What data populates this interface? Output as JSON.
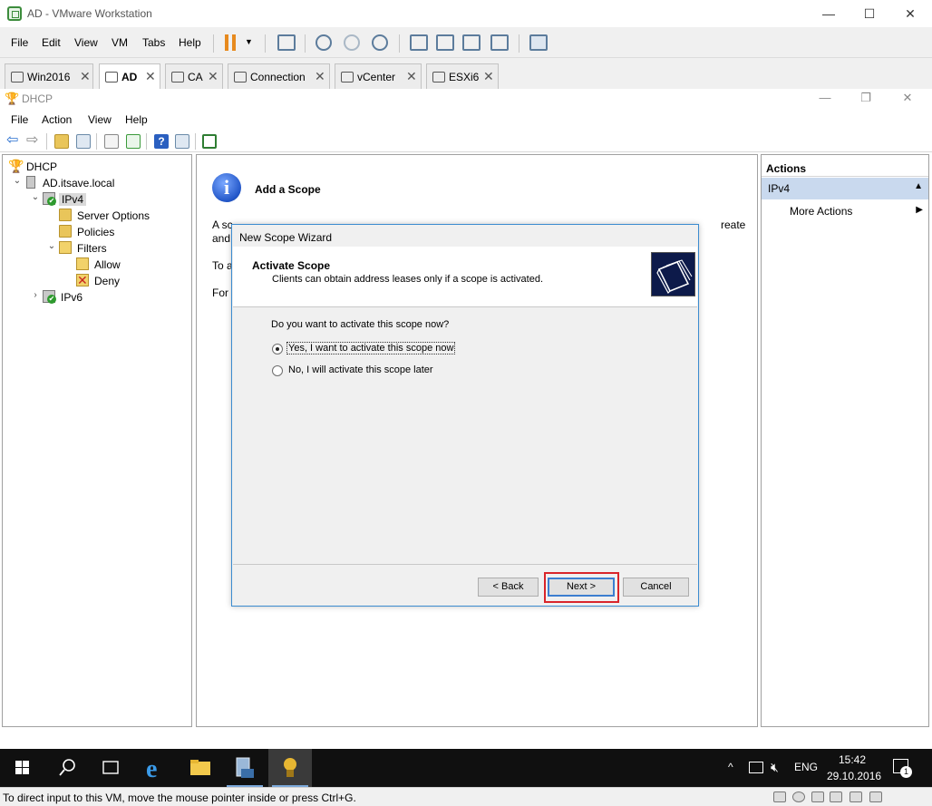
{
  "vmware": {
    "title": "AD - VMware Workstation",
    "window_controls": {
      "minimize": "—",
      "maximize": "☐",
      "close": "✕"
    },
    "menu": [
      "File",
      "Edit",
      "View",
      "VM",
      "Tabs",
      "Help"
    ],
    "tabs": [
      {
        "label": "Win2016",
        "active": false
      },
      {
        "label": "AD",
        "active": true
      },
      {
        "label": "CA",
        "active": false
      },
      {
        "label": "Connection",
        "active": false
      },
      {
        "label": "vCenter",
        "active": false
      },
      {
        "label": "ESXi6",
        "active": false
      }
    ],
    "tab_close": "✕",
    "status_message": "To direct input to this VM, move the mouse pointer inside or press Ctrl+G."
  },
  "mmc": {
    "title": "DHCP",
    "window_controls": {
      "minimize": "—",
      "maximize": "❐",
      "close": "✕"
    },
    "menu": [
      "File",
      "Action",
      "View",
      "Help"
    ],
    "tree": [
      {
        "label": "DHCP",
        "icon": "dhcp-icon",
        "level": 0
      },
      {
        "label": "AD.itsave.local",
        "icon": "server-icon",
        "level": 1,
        "expander": "⌄"
      },
      {
        "label": "IPv4",
        "icon": "ipv4-icon",
        "level": 2,
        "expander": "⌄",
        "selected": true
      },
      {
        "label": "Server Options",
        "icon": "folder-icon",
        "level": 3
      },
      {
        "label": "Policies",
        "icon": "folder-icon",
        "level": 3
      },
      {
        "label": "Filters",
        "icon": "filter-icon",
        "level": 3,
        "expander": "⌄"
      },
      {
        "label": "Allow",
        "icon": "allow-icon",
        "level": 4
      },
      {
        "label": "Deny",
        "icon": "deny-icon",
        "level": 4
      },
      {
        "label": "IPv6",
        "icon": "ipv4-icon",
        "level": 2,
        "expander": "›"
      }
    ],
    "center": {
      "heading": "Add a Scope",
      "lines": [
        "A sc",
        "and",
        "To a",
        "For"
      ],
      "line_right": "reate"
    },
    "actions": {
      "header": "Actions",
      "group": "IPv4",
      "item": "More Actions"
    }
  },
  "wizard": {
    "title": "New Scope Wizard",
    "page_title": "Activate Scope",
    "page_subtitle": "Clients can obtain address leases only if a scope is activated.",
    "question": "Do you want to activate this scope now?",
    "options": [
      {
        "label": "Yes, I want to activate this scope now",
        "checked": true
      },
      {
        "label": "No, I will activate this scope later",
        "checked": false
      }
    ],
    "buttons": {
      "back": "< Back",
      "next": "Next >",
      "cancel": "Cancel"
    },
    "highlight_color": "#d9252a"
  },
  "taskbar": {
    "tray": {
      "chevron": "^",
      "lang": "ENG",
      "notification_count": "1"
    },
    "time": "15:42",
    "date": "29.10.2016"
  }
}
